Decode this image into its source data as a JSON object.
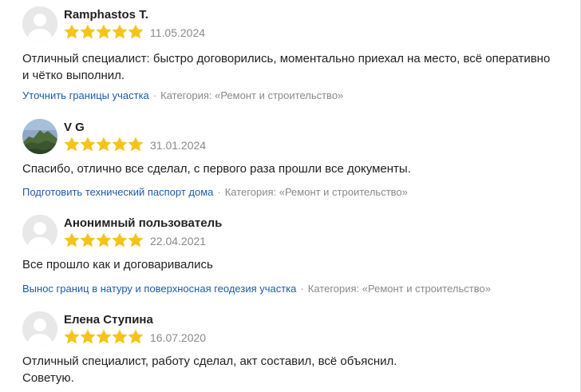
{
  "colors": {
    "star": "#f7c31b",
    "link": "#1d5ca8",
    "muted": "#8a8a8a",
    "text": "#222222"
  },
  "rating_icon": "star-icon",
  "reviews": [
    {
      "author": "Ramphastos T.",
      "avatar": "default-avatar-icon",
      "rating": 5,
      "date": "11.05.2024",
      "text_lines": [
        "Отличный специалист: быстро договорились, моментально приехал на место, всё оперативно",
        "и чётко выполнил."
      ],
      "service": "Уточнить границы участка",
      "separator": "·",
      "category": "Категория: «Ремонт и строительство»"
    },
    {
      "author": "V G",
      "avatar": "mountain-photo-avatar",
      "rating": 5,
      "date": "31.01.2024",
      "text_lines": [
        "Спасибо, отлично все сделал, с первого раза прошли все документы."
      ],
      "service": "Подготовить технический паспорт дома",
      "separator": "·",
      "category": "Категория: «Ремонт и строительство»"
    },
    {
      "author": "Анонимный пользователь",
      "avatar": "default-avatar-icon",
      "rating": 5,
      "date": "22.04.2021",
      "text_lines": [
        "Все прошло как и договаривались"
      ],
      "service": "Вынос границ в натуру и поверхносная геодезия участка",
      "separator": "·",
      "category": "Категория: «Ремонт и строительство»"
    },
    {
      "author": "Елена Ступина",
      "avatar": "default-avatar-icon",
      "rating": 5,
      "date": "16.07.2020",
      "text_lines": [
        "Отличный специалист, работу сделал, акт составил, всё объяснил.",
        "Советую."
      ],
      "service": "",
      "separator": "",
      "category": ""
    }
  ]
}
